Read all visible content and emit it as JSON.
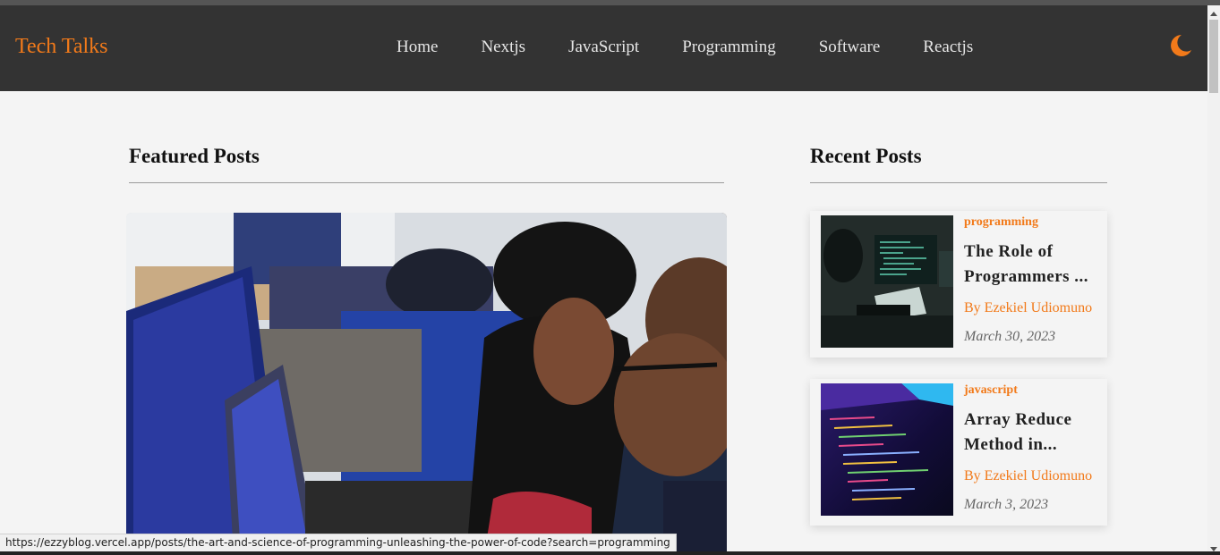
{
  "navbar": {
    "brand": "Tech Talks",
    "links": [
      "Home",
      "Nextjs",
      "JavaScript",
      "Programming",
      "Software",
      "Reactjs"
    ],
    "theme_icon": "moon-icon"
  },
  "featured": {
    "title": "Featured Posts"
  },
  "recent": {
    "title": "Recent Posts",
    "posts": [
      {
        "tag": "programming",
        "title": "The Role of Programmers ...",
        "author": "By Ezekiel Udiomuno",
        "date": "March 30, 2023"
      },
      {
        "tag": "javascript",
        "title": "Array Reduce Method in...",
        "author": "By Ezekiel Udiomuno",
        "date": "March 3, 2023"
      }
    ]
  },
  "status_bar": {
    "url": "https://ezzyblog.vercel.app/posts/the-art-and-science-of-programming-unleashing-the-power-of-code?search=programming"
  },
  "colors": {
    "accent": "#f27a1a",
    "navbar_bg": "#333333",
    "page_bg": "#f4f4f4"
  }
}
